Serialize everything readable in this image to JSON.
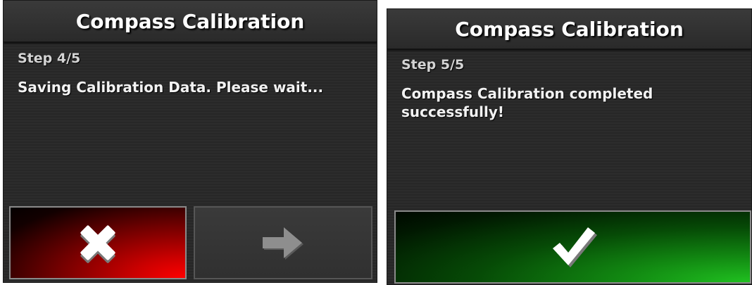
{
  "left_dialog": {
    "title": "Compass Calibration",
    "step": "Step 4/5",
    "message": "Saving Calibration Data. Please wait...",
    "buttons": {
      "cancel_icon": "close-x-icon",
      "next_icon": "arrow-right-icon"
    }
  },
  "right_dialog": {
    "title": "Compass Calibration",
    "step": "Step 5/5",
    "message": "Compass Calibration completed successfully!",
    "buttons": {
      "confirm_icon": "checkmark-icon"
    }
  },
  "colors": {
    "cancel_accent": "#ff0000",
    "confirm_accent": "#20c020",
    "panel_bg": "#2c2c2c",
    "next_disabled": "#8a8a8a"
  }
}
